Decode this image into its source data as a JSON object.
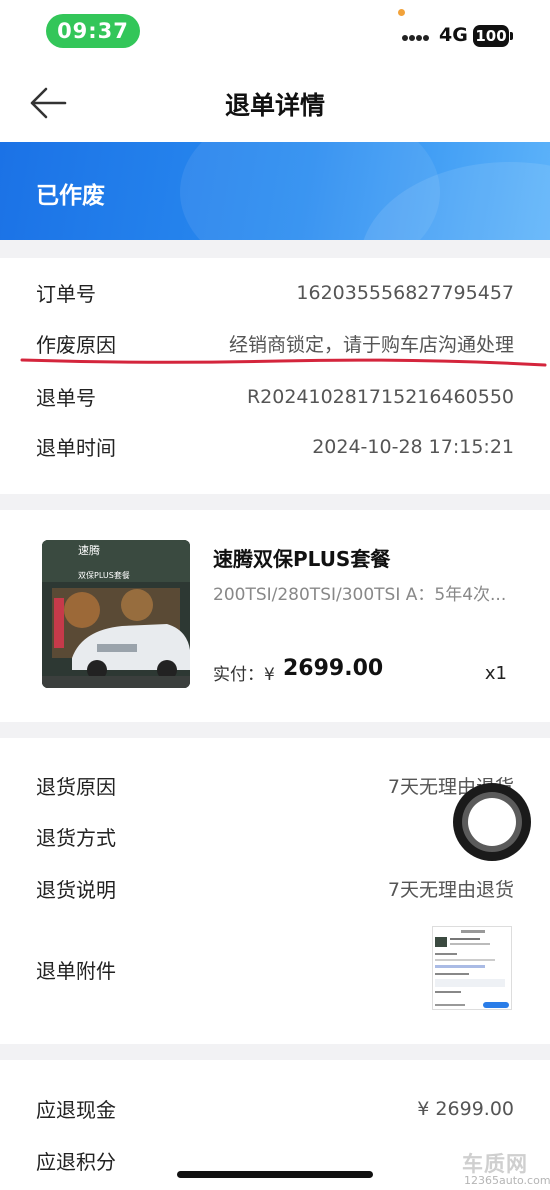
{
  "status_bar": {
    "time": "09:37",
    "network": "4G",
    "battery": "100"
  },
  "nav": {
    "title": "退单详情",
    "back_icon": "arrow-left-icon"
  },
  "banner": {
    "status": "已作废"
  },
  "order_info": {
    "rows": [
      {
        "label": "订单号",
        "value": "162035556827795457"
      },
      {
        "label": "作废原因",
        "value": "经销商锁定，请于购车店沟通处理"
      },
      {
        "label": "退单号",
        "value": "R2024102817152164605​50"
      },
      {
        "label": "退单时间",
        "value": "2024-10-28 17:15:21"
      }
    ]
  },
  "product": {
    "image_brand_text": "速腾",
    "image_sub_text": "双保PLUS套餐",
    "name": "速腾双保PLUS套餐",
    "spec": "200TSI/280TSI/300TSI A：5年4次...",
    "price_label": "实付：",
    "currency": "¥",
    "price": "2699.00",
    "quantity": "x1"
  },
  "return_info": {
    "reason_label": "退货原因",
    "reason_value": "7天无理由退货",
    "method_label": "退货方式",
    "method_value": "",
    "desc_label": "退货说明",
    "desc_value": "7天无理由退货",
    "attach_label": "退单附件"
  },
  "refund": {
    "cash_label": "应退现金",
    "cash_value": "¥ 2699.00",
    "points_label": "应退积分"
  },
  "watermark": {
    "logo": "车质网",
    "url": "12365auto.com"
  },
  "colors": {
    "banner_start": "#1b72e6",
    "banner_end": "#5db3fa",
    "time_pill": "#33c659",
    "annotation_line": "#d4253c"
  }
}
